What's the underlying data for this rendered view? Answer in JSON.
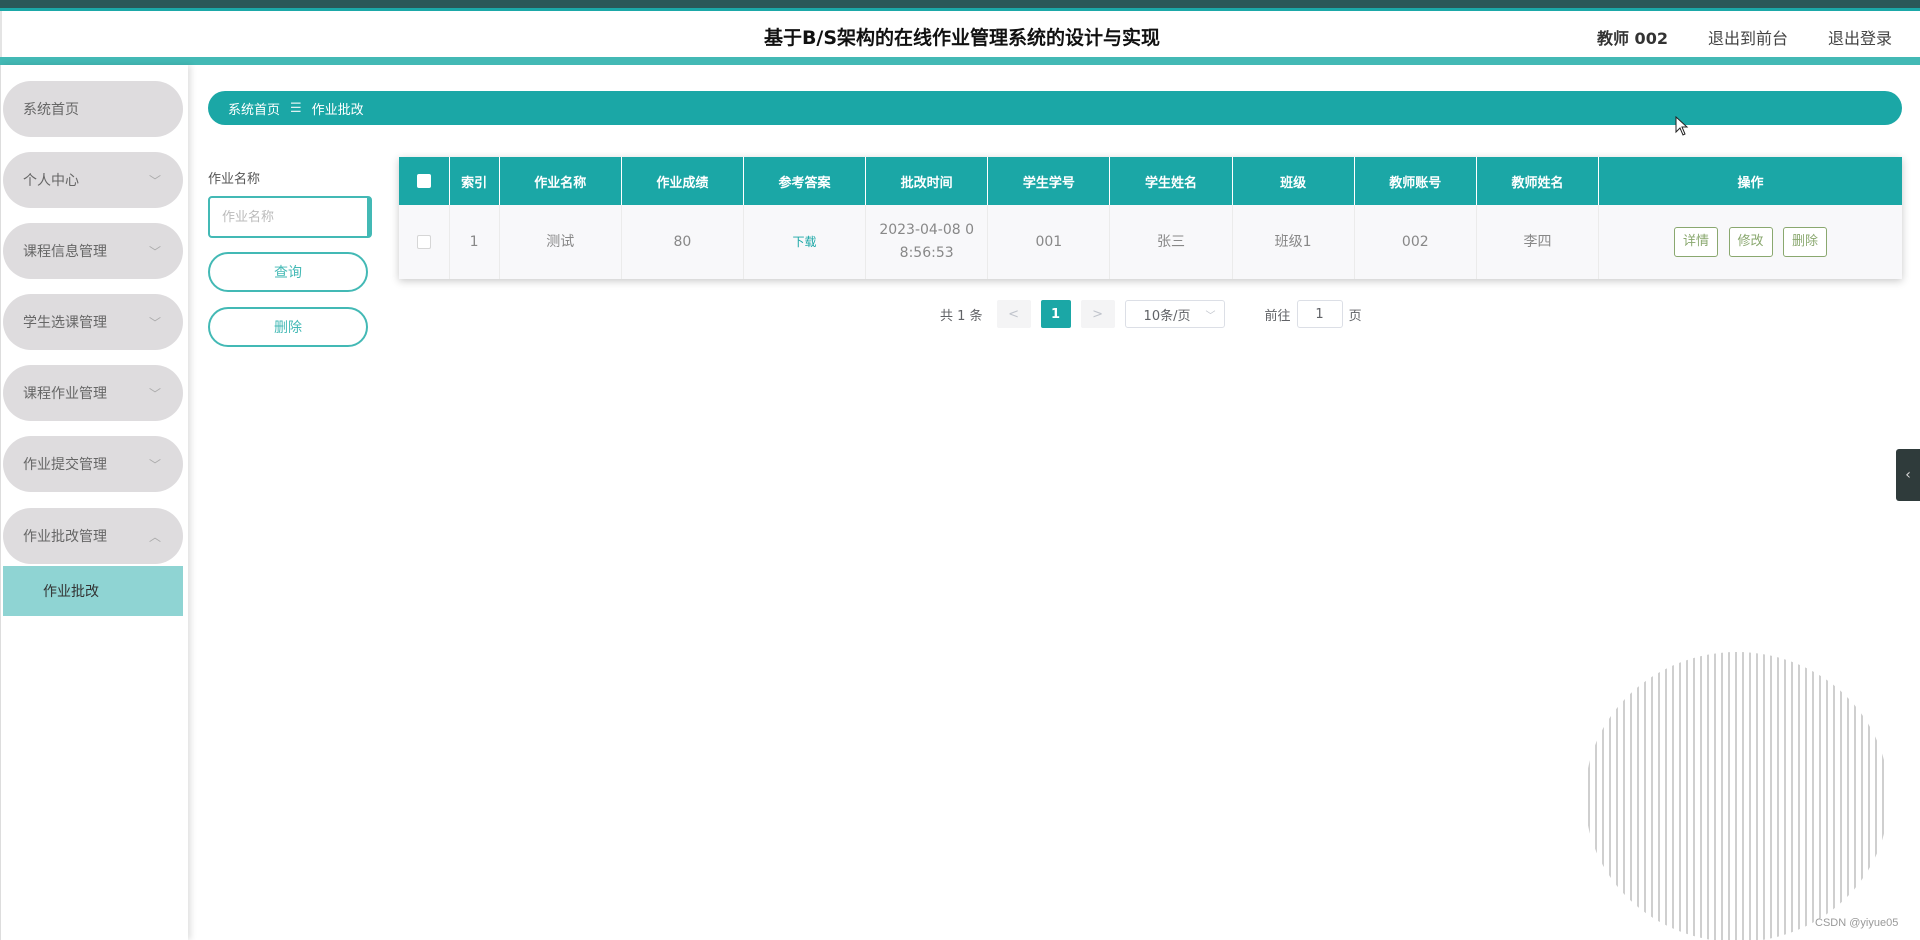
{
  "header": {
    "title": "基于B/S架构的在线作业管理系统的设计与实现",
    "user_name": "教师 002",
    "goto_front": "退出到前台",
    "logout": "退出登录"
  },
  "sidebar": {
    "items": [
      {
        "label": "系统首页"
      },
      {
        "label": "个人中心"
      },
      {
        "label": "课程信息管理"
      },
      {
        "label": "学生选课管理"
      },
      {
        "label": "课程作业管理"
      },
      {
        "label": "作业提交管理"
      },
      {
        "label": "作业批改管理"
      }
    ],
    "subitem": "作业批改"
  },
  "breadcrumb": {
    "home": "系统首页",
    "sep": "☰",
    "current": "作业批改"
  },
  "search": {
    "label": "作业名称",
    "placeholder": "作业名称",
    "query_button": "查询",
    "delete_button": "删除"
  },
  "table": {
    "headers": [
      "索引",
      "作业名称",
      "作业成绩",
      "参考答案",
      "批改时间",
      "学生学号",
      "学生姓名",
      "班级",
      "教师账号",
      "教师姓名",
      "操作"
    ],
    "rows": [
      {
        "index": "1",
        "name": "测试",
        "score": "80",
        "answer": "下载",
        "time_line1": "2023-04-08 0",
        "time_line2": "8:56:53",
        "student_id": "001",
        "student_name": "张三",
        "class": "班级1",
        "teacher_account": "002",
        "teacher_name": "李四"
      }
    ],
    "actions": {
      "detail": "详情",
      "edit": "修改",
      "delete": "删除"
    }
  },
  "pagination": {
    "total": "共 1 条",
    "prev": "<",
    "page": "1",
    "next": ">",
    "page_size": "10条/页",
    "goto_label": "前往",
    "goto_value": "1",
    "page_unit": "页"
  },
  "icons": {
    "chevron_down": "chevron-down-icon",
    "chevron_up": "chevron-up-icon",
    "collapse": "chevron-left-icon"
  },
  "colors": {
    "primary": "#1ba7a6",
    "accent_light": "#8fd4d3",
    "menu_bg": "#dedcde",
    "op_button": "#8aa86f"
  },
  "watermark": "CSDN @yiyue05"
}
